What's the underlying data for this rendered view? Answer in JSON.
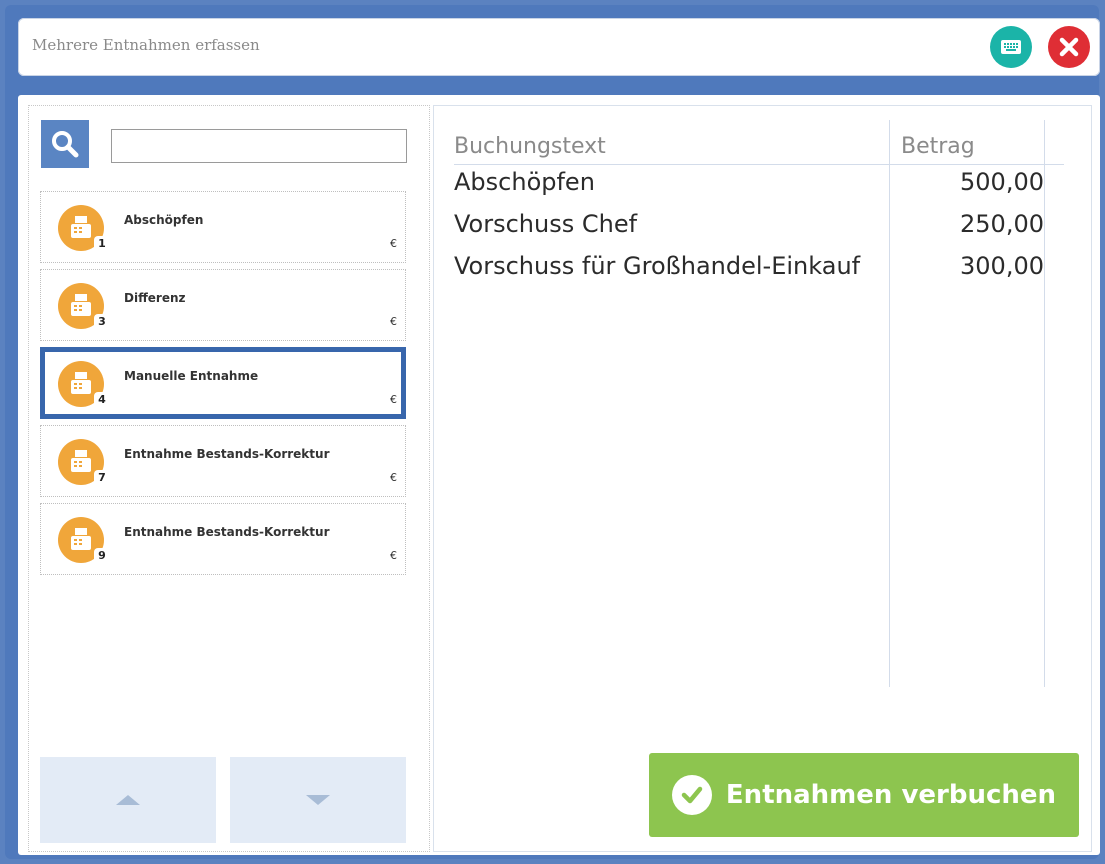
{
  "window": {
    "title": "Mehrere Entnahmen erfassen",
    "icons": {
      "keyboard": "keyboard-icon",
      "close": "close-icon"
    }
  },
  "search": {
    "value": "",
    "placeholder": ""
  },
  "items": [
    {
      "label": "Abschöpfen",
      "number": "1",
      "currency": "€",
      "selected": false
    },
    {
      "label": "Differenz",
      "number": "3",
      "currency": "€",
      "selected": false
    },
    {
      "label": "Manuelle Entnahme",
      "number": "4",
      "currency": "€",
      "selected": true
    },
    {
      "label": "Entnahme Bestands-Korrektur",
      "number": "7",
      "currency": "€",
      "selected": false
    },
    {
      "label": "Entnahme Bestands-Korrektur",
      "number": "9",
      "currency": "€",
      "selected": false
    }
  ],
  "table": {
    "headers": {
      "text": "Buchungstext",
      "amount": "Betrag"
    },
    "rows": [
      {
        "text": "Abschöpfen",
        "amount": "500,00"
      },
      {
        "text": "Vorschuss Chef",
        "amount": "250,00"
      },
      {
        "text": "Vorschuss für Großhandel-Einkauf",
        "amount": "300,00"
      }
    ]
  },
  "actions": {
    "book_label": "Entnahmen verbuchen"
  },
  "colors": {
    "frame": "#4f79bc",
    "accent_blue": "#3866ac",
    "item_icon": "#f0a63a",
    "book_button": "#8dc54f",
    "keyboard_button": "#1bb4a8",
    "close_button": "#df2e35"
  }
}
